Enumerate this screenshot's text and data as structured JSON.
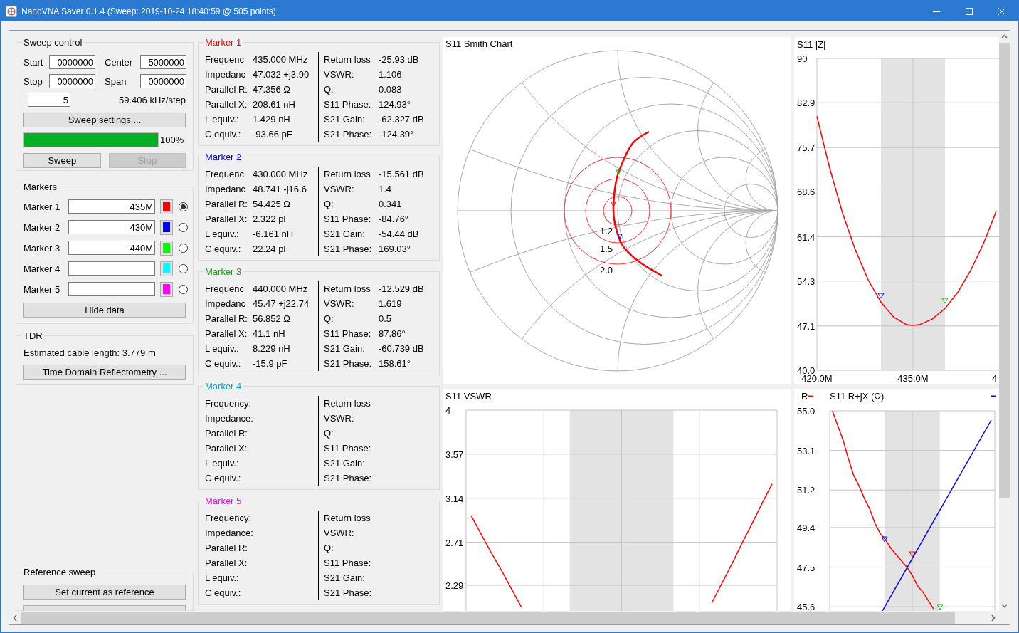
{
  "window": {
    "title": "NanoVNA Saver 0.1.4 (Sweep: 2019-10-24 18:40:59 @ 505 points)"
  },
  "sweep_control": {
    "title": "Sweep control",
    "fields": [
      {
        "label": "Start",
        "value": "0000000"
      },
      {
        "label": "Center",
        "value": "5000000"
      },
      {
        "label": "Stop",
        "value": "0000000"
      },
      {
        "label": "Span",
        "value": "0000000"
      }
    ],
    "segments": "5",
    "step": "59.406 kHz/step",
    "settings_button": "Sweep settings ...",
    "progress": {
      "level": 1,
      "reading": "100%"
    },
    "buttons": [
      {
        "label": "Sweep",
        "disabled": false
      },
      {
        "label": "Stop",
        "disabled": true
      }
    ]
  },
  "markers": {
    "title": "Markers",
    "items": [
      {
        "label": "Marker 1",
        "value": "435M",
        "color": "#ff0000",
        "selected": true
      },
      {
        "label": "Marker 2",
        "value": "430M",
        "color": "#0000ff",
        "selected": false
      },
      {
        "label": "Marker 3",
        "value": "440M",
        "color": "#00ff00",
        "selected": false
      },
      {
        "label": "Marker 4",
        "color": "#00ffff",
        "selected": false
      },
      {
        "label": "Marker 5",
        "color": "#ff00ff",
        "selected": false
      }
    ],
    "button": "Hide data"
  },
  "tdr": {
    "title": "TDR",
    "cable_length": "Estimated cable length: 3.779 m",
    "button": "Time Domain Reflectometry ..."
  },
  "reference_sweep": {
    "title": "Reference sweep",
    "button": "Set current as reference"
  },
  "marker_data": [
    {
      "title": "Marker 1",
      "color": "#ff0000",
      "left": [
        {
          "label": "Frequenc",
          "value": "435.000 MHz"
        },
        {
          "label": "Impedanc",
          "value": "47.032 +j3.90"
        },
        {
          "label": "Parallel R:",
          "value": "47.356 Ω"
        },
        {
          "label": "Parallel X:",
          "value": "208.61 nH"
        },
        {
          "label": "L equiv.:",
          "value": "1.429 nH"
        },
        {
          "label": "C equiv.:",
          "value": "-93.66 pF"
        }
      ],
      "right": [
        {
          "label": "Return loss",
          "value": "-25.93 dB"
        },
        {
          "label": "VSWR:",
          "value": "1.106"
        },
        {
          "label": "Q:",
          "value": "0.083"
        },
        {
          "label": "S11 Phase:",
          "value": "124.93°"
        },
        {
          "label": "S21 Gain:",
          "value": "-62.327 dB"
        },
        {
          "label": "S21 Phase:",
          "value": "-124.39°"
        }
      ]
    },
    {
      "title": "Marker 2",
      "color": "#0000ff",
      "left": [
        {
          "label": "Frequenc",
          "value": "430.000 MHz"
        },
        {
          "label": "Impedanc",
          "value": "48.741 -j16.6"
        },
        {
          "label": "Parallel R:",
          "value": "54.425 Ω"
        },
        {
          "label": "Parallel X:",
          "value": "2.322 pF"
        },
        {
          "label": "L equiv.:",
          "value": "-6.161 nH"
        },
        {
          "label": "C equiv.:",
          "value": "22.24 pF"
        }
      ],
      "right": [
        {
          "label": "Return loss",
          "value": "-15.561 dB"
        },
        {
          "label": "VSWR:",
          "value": "1.4"
        },
        {
          "label": "Q:",
          "value": "0.341"
        },
        {
          "label": "S11 Phase:",
          "value": "-84.76°"
        },
        {
          "label": "S21 Gain:",
          "value": "-54.44 dB"
        },
        {
          "label": "S21 Phase:",
          "value": "169.03°"
        }
      ]
    },
    {
      "title": "Marker 3",
      "color": "#00b000",
      "left": [
        {
          "label": "Frequenc",
          "value": "440.000 MHz"
        },
        {
          "label": "Impedanc",
          "value": "45.47 +j22.74"
        },
        {
          "label": "Parallel R:",
          "value": "56.852 Ω"
        },
        {
          "label": "Parallel X:",
          "value": "41.1 nH"
        },
        {
          "label": "L equiv.:",
          "value": "8.229 nH"
        },
        {
          "label": "C equiv.:",
          "value": "-15.9 pF"
        }
      ],
      "right": [
        {
          "label": "Return loss",
          "value": "-12.529 dB"
        },
        {
          "label": "VSWR:",
          "value": "1.619"
        },
        {
          "label": "Q:",
          "value": "0.5"
        },
        {
          "label": "S11 Phase:",
          "value": "87.86°"
        },
        {
          "label": "S21 Gain:",
          "value": "-60.739 dB"
        },
        {
          "label": "S21 Phase:",
          "value": "158.61°"
        }
      ]
    },
    {
      "title": "Marker 4",
      "color": "#00a8c8",
      "left": [
        {
          "label": "Frequency:"
        },
        {
          "label": "Impedance:"
        },
        {
          "label": "Parallel R:"
        },
        {
          "label": "Parallel X:"
        },
        {
          "label": "L equiv.:"
        },
        {
          "label": "C equiv.:"
        }
      ],
      "right": [
        {
          "label": "Return loss"
        },
        {
          "label": "VSWR:"
        },
        {
          "label": "Q:"
        },
        {
          "label": "S11 Phase:"
        },
        {
          "label": "S21 Gain:"
        },
        {
          "label": "S21 Phase:"
        }
      ]
    },
    {
      "title": "Marker 5",
      "color": "#ff00ff",
      "left": [
        {
          "label": "Frequency:"
        },
        {
          "label": "Impedance:"
        },
        {
          "label": "Parallel R:"
        },
        {
          "label": "Parallel X:"
        },
        {
          "label": "L equiv.:"
        },
        {
          "label": "C equiv.:"
        }
      ],
      "right": [
        {
          "label": "Return loss"
        },
        {
          "label": "VSWR:"
        },
        {
          "label": "Q:"
        },
        {
          "label": "S11 Phase:"
        },
        {
          "label": "S21 Gain:"
        },
        {
          "label": "S21 Phase:"
        }
      ]
    }
  ],
  "charts": {
    "smith": {
      "title": "S11 Smith Chart",
      "circle_labels": [
        "1.2",
        "1.5",
        "2.0"
      ]
    },
    "impedance": {
      "title": "S11 |Z|",
      "edge_label": "4",
      "chart_data": {
        "type": "line",
        "x": [
          420,
          422,
          424,
          426,
          428,
          430,
          432,
          434,
          435,
          436,
          438,
          440,
          442,
          444,
          446,
          448
        ],
        "series": [
          {
            "color": "#ff0000",
            "values": [
              80.7,
              72.4,
              65.2,
              59.3,
              54.5,
              50.9,
              48.5,
              47.3,
              47.2,
              47.3,
              48.2,
              49.9,
              52.5,
              56.0,
              60.3,
              65.5
            ]
          }
        ],
        "xlim": [
          420,
          450
        ],
        "ylim": [
          40,
          90
        ],
        "grid": true,
        "xticks": [
          {
            "value": 420,
            "label": "420.0M"
          },
          {
            "value": 435,
            "label": "435.0M"
          }
        ],
        "yticks": [
          90,
          82.9,
          75.7,
          68.6,
          61.4,
          54.3,
          47.1,
          {
            "value": 40,
            "label": "40.0"
          }
        ]
      }
    },
    "vswr": {
      "title": "S11 VSWR",
      "chart_data": {
        "type": "line",
        "categories": [
          null,
          null,
          null,
          null,
          null,
          null,
          null,
          null,
          null,
          null,
          null,
          null,
          null,
          null,
          null,
          null,
          null,
          null,
          null,
          null,
          null,
          null,
          null,
          null,
          null,
          null,
          null,
          null,
          null,
          null,
          null
        ],
        "series": [
          {
            "color": "#ff0000",
            "values": [
              2.97,
              2.79,
              2.61,
              2.44,
              2.26,
              2.08,
              null,
              null,
              null,
              null,
              null,
              null,
              null,
              null,
              null,
              null,
              null,
              null,
              null,
              null,
              null,
              null,
              null,
              null,
              null,
              null,
              null,
              null,
              null,
              null,
              null
            ]
          },
          {
            "color": "#ff0000",
            "values": [
              null,
              null,
              null,
              null,
              null,
              null,
              null,
              null,
              null,
              null,
              null,
              null,
              null,
              null,
              null,
              null,
              null,
              null,
              null,
              null,
              null,
              null,
              null,
              null,
              2.12,
              2.31,
              2.5,
              2.7,
              2.89,
              3.09,
              3.28
            ]
          }
        ],
        "ylim": [
          2.04,
          4
        ],
        "grid": true,
        "yticks": [
          4,
          3.57,
          3.14,
          2.71,
          2.29
        ]
      }
    },
    "rjx": {
      "title": "S11 R+jX (Ω)",
      "legend": "R",
      "chart_data": {
        "type": "line",
        "categories": [
          null,
          null,
          null,
          null,
          null,
          null,
          null,
          null,
          null,
          null,
          null,
          null,
          null,
          null,
          null,
          null,
          null,
          null,
          null,
          null,
          null,
          null,
          null,
          null,
          null,
          null,
          null,
          null,
          null,
          null,
          null
        ],
        "series": [
          {
            "color": "#ff0000",
            "values": [
              55.0,
              54.3,
              53.6,
              52.7,
              51.9,
              51.4,
              50.8,
              50.3,
              49.6,
              49.1,
              48.8,
              48.4,
              48.1,
              47.8,
              47.5,
              47.1,
              46.6,
              46.3,
              45.9,
              45.5,
              null,
              null,
              null,
              null,
              null,
              null,
              null,
              null,
              null,
              null,
              null
            ]
          }
        ],
        "ylim": [
          45.4,
          55
        ],
        "grid": true,
        "yticks": [
          {
            "value": 55,
            "label": "55.0"
          },
          53.1,
          51.2,
          49.4,
          47.5,
          45.6
        ]
      }
    }
  }
}
